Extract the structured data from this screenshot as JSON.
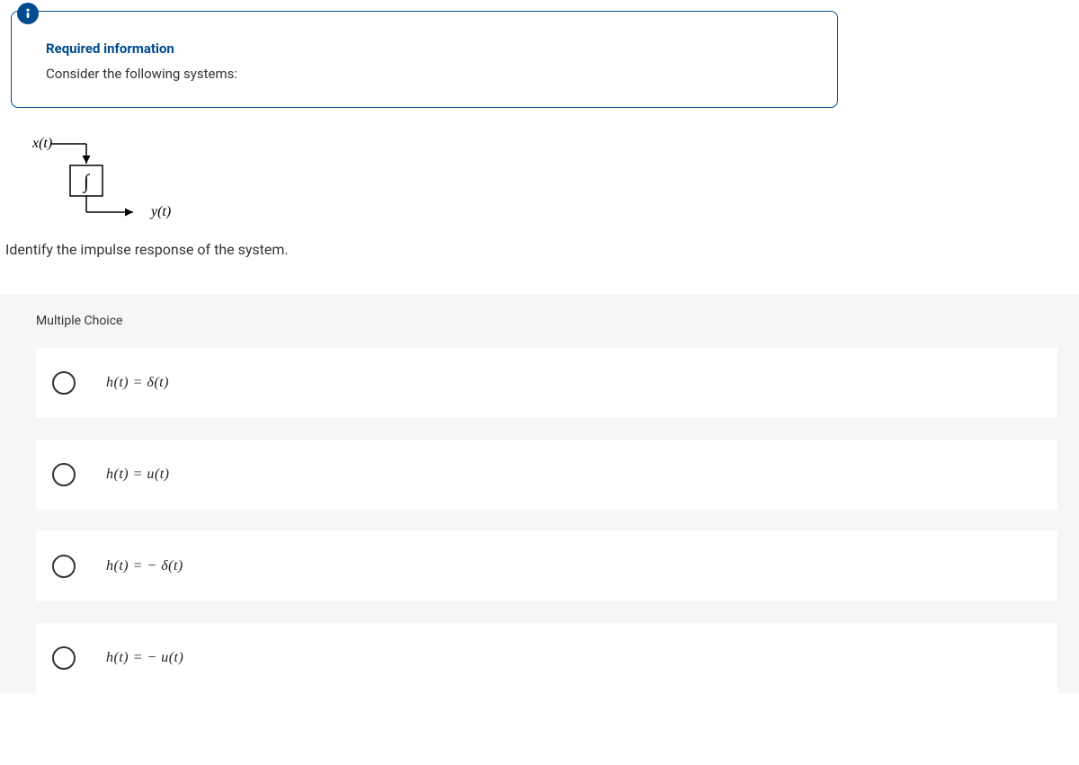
{
  "info": {
    "title": "Required information",
    "text": "Consider the following systems:"
  },
  "diagram": {
    "input_label": "x(t)",
    "block_symbol": "∫",
    "output_label": "y(t)"
  },
  "prompt": "Identify the impulse response of the system.",
  "mc": {
    "header": "Multiple Choice",
    "choices": [
      "h(t)  =  δ(t)",
      "h(t)  =  u(t)",
      "h(t)  =  − δ(t)",
      "h(t)  =  − u(t)"
    ]
  }
}
